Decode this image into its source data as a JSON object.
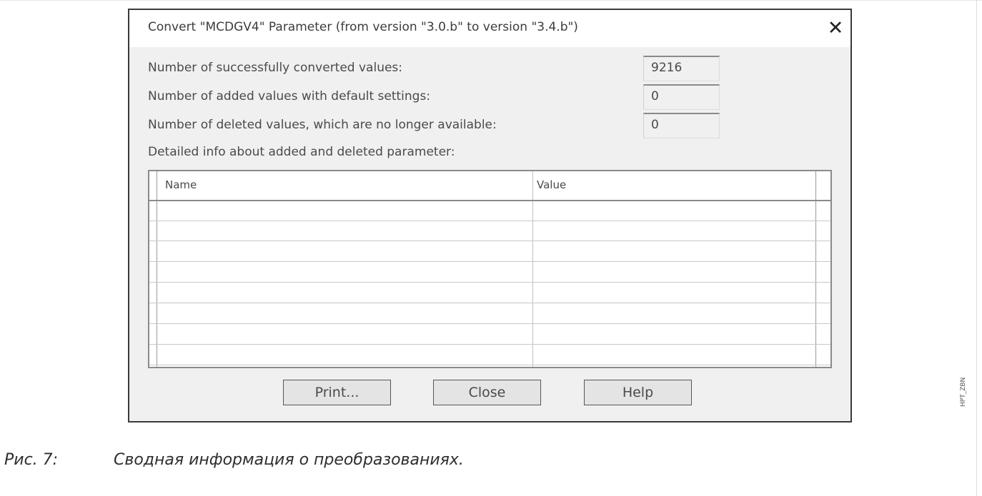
{
  "dialog": {
    "title": "Convert \"MCDGV4\" Parameter (from version \"3.0.b\" to version \"3.4.b\")",
    "close_glyph": "✕",
    "stats": [
      {
        "label": "Number of successfully converted values:",
        "value": "9216"
      },
      {
        "label": "Number of added values with default settings:",
        "value": "0"
      },
      {
        "label": "Number of deleted values, which are no longer available:",
        "value": "0"
      }
    ],
    "detail_label": "Detailed info about added and deleted parameter:",
    "table": {
      "columns": [
        "Name",
        "Value"
      ],
      "rows": []
    },
    "buttons": {
      "print": "Print...",
      "close": "Close",
      "help": "Help"
    }
  },
  "side_code": "HPT_ZBN",
  "caption": {
    "number": "Рис. 7:",
    "text": "Сводная информация о преобразованиях."
  }
}
